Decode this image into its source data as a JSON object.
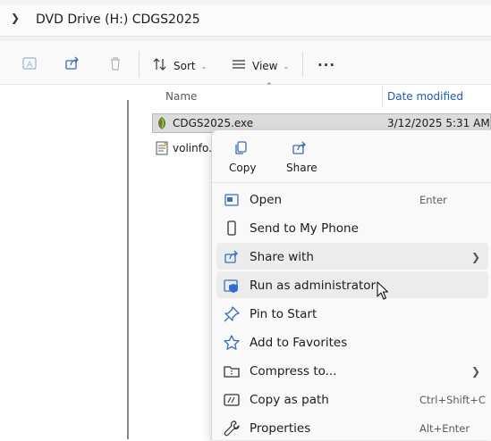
{
  "address": {
    "path": "DVD Drive (H:) CDGS2025"
  },
  "toolbar": {
    "sort_label": "Sort",
    "view_label": "View",
    "more_label": "..."
  },
  "columns": {
    "name": "Name",
    "date_modified": "Date modified"
  },
  "files": [
    {
      "name": "CDGS2025.exe",
      "date": "3/12/2025 5:31 AM"
    },
    {
      "name": "volinfo.t"
    }
  ],
  "context_menu": {
    "top_actions": [
      {
        "label": "Copy"
      },
      {
        "label": "Share"
      }
    ],
    "items": [
      {
        "label": "Open",
        "shortcut": "Enter"
      },
      {
        "label": "Send to My Phone"
      },
      {
        "label": "Share with"
      },
      {
        "label": "Run as administrator"
      },
      {
        "label": "Pin to Start"
      },
      {
        "label": "Add to Favorites"
      },
      {
        "label": "Compress to..."
      },
      {
        "label": "Copy as path",
        "shortcut": "Ctrl+Shift+C"
      },
      {
        "label": "Properties",
        "shortcut": "Alt+Enter"
      }
    ]
  },
  "colors": {
    "accent": "#1f5bb5",
    "menu_bg": "#f9f9f9",
    "hover_bg": "#ececec"
  }
}
